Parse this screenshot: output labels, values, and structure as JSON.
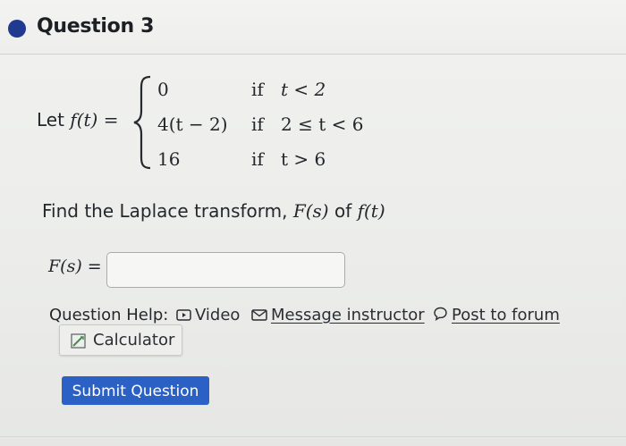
{
  "question": {
    "title": "Question 3",
    "status_color": "#1f3a8f"
  },
  "function_def": {
    "lead": "Let",
    "fname": "f(t) =",
    "cases": [
      {
        "value": "0",
        "keyword": "if",
        "condition": "t < 2"
      },
      {
        "value": "4(t − 2)",
        "keyword": "if",
        "condition": "2 ≤ t < 6"
      },
      {
        "value": "16",
        "keyword": "if",
        "condition": "t > 6"
      }
    ]
  },
  "prompt": {
    "text_before": "Find the Laplace transform,",
    "Fs": "F(s)",
    "text_of": "of",
    "ft": "f(t)"
  },
  "answer": {
    "label_math": "F(s)",
    "label_eq": " =",
    "value": ""
  },
  "help": {
    "label": "Question Help:",
    "video_label": "Video",
    "message_label": "Message instructor",
    "forum_label": "Post to forum",
    "calculator_label": "Calculator",
    "icons": [
      "video-icon",
      "mail-icon",
      "forum-icon",
      "calculator-icon"
    ]
  },
  "submit": {
    "label": "Submit Question",
    "color": "#2b60c4"
  }
}
